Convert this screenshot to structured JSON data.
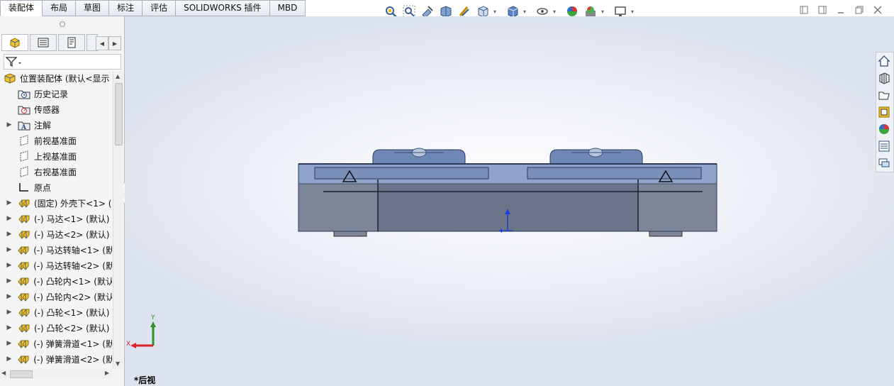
{
  "tabs": [
    {
      "label": "装配体",
      "active": true
    },
    {
      "label": "布局",
      "active": false
    },
    {
      "label": "草图",
      "active": false
    },
    {
      "label": "标注",
      "active": false
    },
    {
      "label": "评估",
      "active": false
    },
    {
      "label": "SOLIDWORKS 插件",
      "active": false
    },
    {
      "label": "MBD",
      "active": false
    }
  ],
  "hud_icons": [
    "zoom-to-fit-icon",
    "zoom-to-area-icon",
    "previous-view-icon",
    "section-view-icon",
    "dynamic-annotation-icon",
    "view-orientation-icon",
    "display-style-icon",
    "hide-show-icon",
    "edit-appearance-icon",
    "apply-scene-icon",
    "view-settings-icon"
  ],
  "tree": {
    "root": "位置装配体 (默认<显示",
    "items": [
      {
        "label": "历史记录",
        "icon": "history-folder-icon",
        "expandable": false
      },
      {
        "label": "传感器",
        "icon": "sensor-icon",
        "expandable": false
      },
      {
        "label": "注解",
        "icon": "annotation-icon",
        "expandable": true
      },
      {
        "label": "前视基准面",
        "icon": "plane-icon",
        "expandable": false
      },
      {
        "label": "上视基准面",
        "icon": "plane-icon",
        "expandable": false
      },
      {
        "label": "右视基准面",
        "icon": "plane-icon",
        "expandable": false
      },
      {
        "label": "原点",
        "icon": "origin-icon",
        "expandable": false
      },
      {
        "label": "(固定) 外壳下<1> (",
        "icon": "part-icon",
        "expandable": true
      },
      {
        "label": "(-) 马达<1> (默认)",
        "icon": "part-icon",
        "expandable": true
      },
      {
        "label": "(-) 马达<2> (默认)",
        "icon": "part-icon",
        "expandable": true
      },
      {
        "label": "(-) 马达转轴<1> (默",
        "icon": "part-icon",
        "expandable": true
      },
      {
        "label": "(-) 马达转轴<2> (默",
        "icon": "part-icon",
        "expandable": true
      },
      {
        "label": "(-) 凸轮内<1> (默认",
        "icon": "part-icon",
        "expandable": true
      },
      {
        "label": "(-) 凸轮内<2> (默认",
        "icon": "part-icon",
        "expandable": true
      },
      {
        "label": "(-) 凸轮<1> (默认)",
        "icon": "part-icon",
        "expandable": true
      },
      {
        "label": "(-) 凸轮<2> (默认)",
        "icon": "part-icon",
        "expandable": true
      },
      {
        "label": "(-) 弹簧滑道<1> (默",
        "icon": "part-icon",
        "expandable": true
      },
      {
        "label": "(-) 弹簧滑道<2> (默",
        "icon": "part-icon",
        "expandable": true
      }
    ]
  },
  "triad": {
    "x_label": "X",
    "y_label": "Y"
  },
  "view_name": "*后视",
  "colors": {
    "accent": "#1e5bb5",
    "model_body": "#6b7488",
    "model_glass": "#8fa4c8"
  }
}
